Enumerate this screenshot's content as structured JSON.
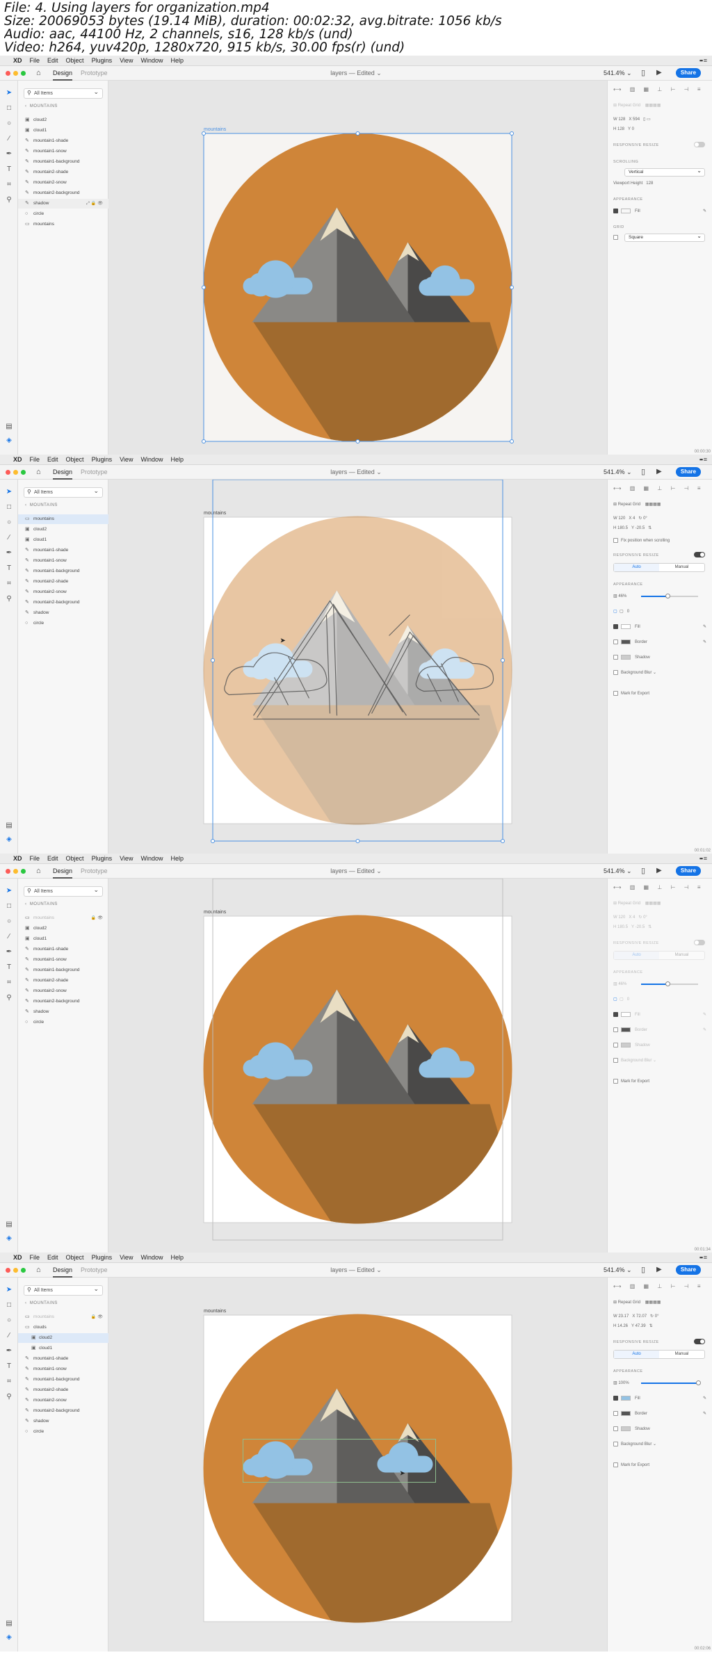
{
  "header": {
    "line1": "File: 4. Using layers for organization.mp4",
    "line2": "Size: 20069053 bytes (19.14 MiB), duration: 00:02:32, avg.bitrate: 1056 kb/s",
    "line3": "Audio: aac, 44100 Hz, 2 channels, s16, 128 kb/s (und)",
    "line4": "Video: h264, yuv420p, 1280x720, 915 kb/s, 30.00 fps(r) (und)"
  },
  "app": {
    "menu": [
      "XD",
      "File",
      "Edit",
      "Object",
      "Plugins",
      "View",
      "Window",
      "Help"
    ],
    "tab_design": "Design",
    "tab_prototype": "Prototype",
    "doc_title": "layers — Edited ⌄",
    "zoom": "541.4% ⌄",
    "share": "Share",
    "filter": "All Items",
    "board_header": "MOUNTAINS",
    "artboard_label": "mountains"
  },
  "frames": [
    {
      "timestamp": "00:00:30",
      "layers": [
        {
          "name": "cloud2",
          "icon": "▣"
        },
        {
          "name": "cloud1",
          "icon": "▣"
        },
        {
          "name": "mountain1-shade",
          "icon": "✎"
        },
        {
          "name": "mountain1-snow",
          "icon": "✎"
        },
        {
          "name": "mountain1-background",
          "icon": "✎"
        },
        {
          "name": "mountain2-shade",
          "icon": "✎"
        },
        {
          "name": "mountain2-snow",
          "icon": "✎"
        },
        {
          "name": "mountain2-background",
          "icon": "✎"
        },
        {
          "name": "shadow",
          "icon": "✎",
          "hover": true
        },
        {
          "name": "circle",
          "icon": "○"
        },
        {
          "name": "mountains",
          "icon": "▭"
        }
      ],
      "inspector": {
        "w": "128",
        "x": "594",
        "h": "128",
        "y": "0",
        "responsive": "RESPONSIVE RESIZE",
        "scrolling": "SCROLLING",
        "scroll_mode": "Vertical",
        "viewport": "Viewport Height",
        "viewport_val": "128",
        "appearance": "APPEARANCE",
        "fill": "Fill",
        "grid": "GRID",
        "grid_mode": "Square"
      }
    },
    {
      "timestamp": "00:01:02",
      "layers": [
        {
          "name": "mountains",
          "icon": "▭",
          "selected": true
        },
        {
          "name": "cloud2",
          "icon": "▣"
        },
        {
          "name": "cloud1",
          "icon": "▣"
        },
        {
          "name": "mountain1-shade",
          "icon": "✎"
        },
        {
          "name": "mountain1-snow",
          "icon": "✎"
        },
        {
          "name": "mountain1-background",
          "icon": "✎"
        },
        {
          "name": "mountain2-shade",
          "icon": "✎"
        },
        {
          "name": "mountain2-snow",
          "icon": "✎"
        },
        {
          "name": "mountain2-background",
          "icon": "✎"
        },
        {
          "name": "shadow",
          "icon": "✎"
        },
        {
          "name": "circle",
          "icon": "○"
        }
      ],
      "inspector": {
        "repeat_grid": "Repeat Grid",
        "w": "120",
        "x": "4",
        "rot": "0°",
        "h": "180.5",
        "y": "-20.5",
        "fix_position": "Fix position when scrolling",
        "responsive": "RESPONSIVE RESIZE",
        "auto": "Auto",
        "manual": "Manual",
        "appearance": "APPEARANCE",
        "opacity": "46%",
        "opacity_value": 46,
        "radius": "0",
        "fill": "Fill",
        "border": "Border",
        "shadow": "Shadow",
        "background_blur": "Background Blur ⌄",
        "mark_export": "Mark for Export"
      }
    },
    {
      "timestamp": "00:01:34",
      "layers": [
        {
          "name": "mountains",
          "icon": "▭",
          "dim": true,
          "locked": true
        },
        {
          "name": "cloud2",
          "icon": "▣"
        },
        {
          "name": "cloud1",
          "icon": "▣"
        },
        {
          "name": "mountain1-shade",
          "icon": "✎"
        },
        {
          "name": "mountain1-snow",
          "icon": "✎"
        },
        {
          "name": "mountain1-background",
          "icon": "✎"
        },
        {
          "name": "mountain2-shade",
          "icon": "✎"
        },
        {
          "name": "mountain2-snow",
          "icon": "✎"
        },
        {
          "name": "mountain2-background",
          "icon": "✎"
        },
        {
          "name": "shadow",
          "icon": "✎"
        },
        {
          "name": "circle",
          "icon": "○"
        }
      ],
      "inspector": {
        "repeat_grid": "Repeat Grid",
        "w": "120",
        "x": "4",
        "rot": "0°",
        "h": "180.5",
        "y": "-20.5",
        "responsive": "RESPONSIVE RESIZE",
        "auto": "Auto",
        "manual": "Manual",
        "appearance": "APPEARANCE",
        "opacity": "46%",
        "opacity_value": 46,
        "radius": "0",
        "fill": "Fill",
        "border": "Border",
        "shadow": "Shadow",
        "background_blur": "Background Blur ⌄",
        "mark_export": "Mark for Export"
      }
    },
    {
      "timestamp": "00:02:06",
      "layers": [
        {
          "name": "mountains",
          "icon": "▭",
          "dim": true,
          "locked": true
        },
        {
          "name": "clouds",
          "icon": "▭"
        },
        {
          "name": "cloud2",
          "icon": "▣",
          "child": true,
          "selected": true
        },
        {
          "name": "cloud1",
          "icon": "▣",
          "child": true
        },
        {
          "name": "mountain1-shade",
          "icon": "✎"
        },
        {
          "name": "mountain1-snow",
          "icon": "✎"
        },
        {
          "name": "mountain1-background",
          "icon": "✎"
        },
        {
          "name": "mountain2-shade",
          "icon": "✎"
        },
        {
          "name": "mountain2-snow",
          "icon": "✎"
        },
        {
          "name": "mountain2-background",
          "icon": "✎"
        },
        {
          "name": "shadow",
          "icon": "✎"
        },
        {
          "name": "circle",
          "icon": "○"
        }
      ],
      "inspector": {
        "repeat_grid": "Repeat Grid",
        "w": "23.17",
        "x": "72.07",
        "rot": "0°",
        "h": "14.26",
        "y": "47.39",
        "responsive": "RESPONSIVE RESIZE",
        "auto": "Auto",
        "manual": "Manual",
        "appearance": "APPEARANCE",
        "opacity": "100%",
        "opacity_value": 100,
        "fill": "Fill",
        "border": "Border",
        "shadow": "Shadow",
        "background_blur": "Background Blur ⌄",
        "mark_export": "Mark for Export"
      }
    }
  ],
  "colors": {
    "orange": "#cf8539",
    "shadow": "#a06a2e",
    "cloud": "#93c2e4",
    "snow": "#e9dec3",
    "mtn_light": "#8a8986",
    "mtn_mid": "#5f5e5c",
    "mtn_dark": "#4a4948",
    "accent": "#1473e6"
  }
}
